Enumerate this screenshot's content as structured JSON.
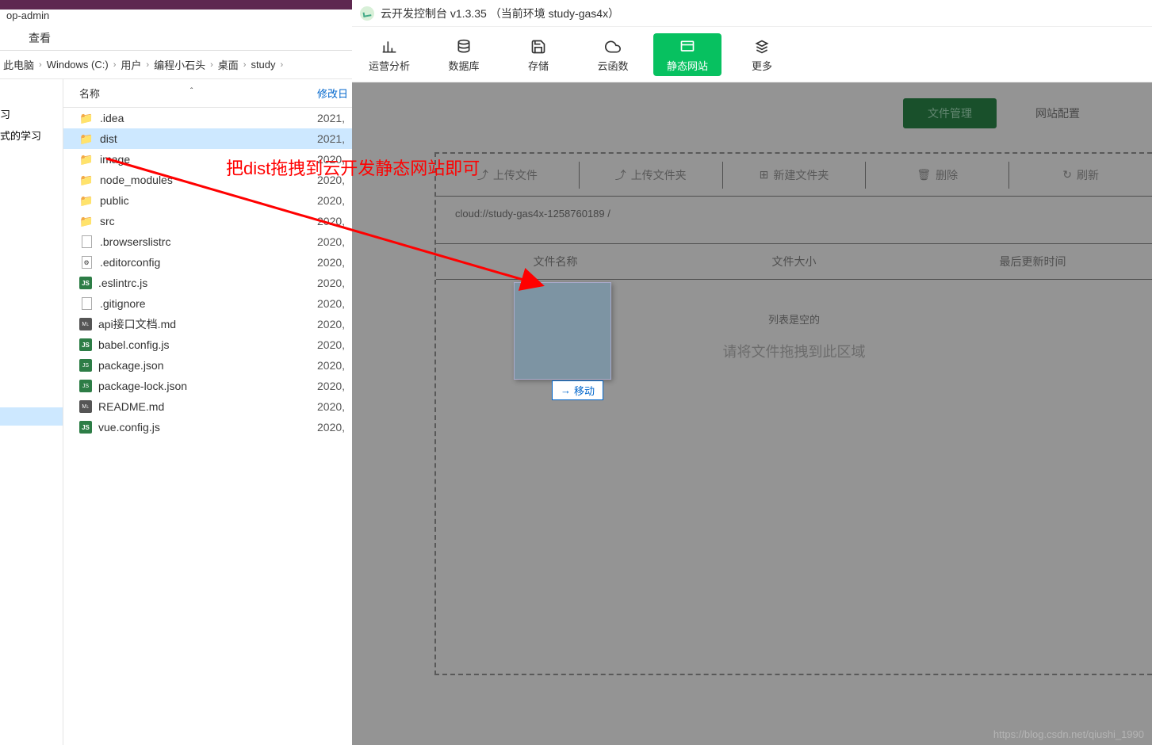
{
  "explorer": {
    "top_label": "op-admin",
    "menu": {
      "view": "查看"
    },
    "breadcrumb": [
      "此电脑",
      "Windows (C:)",
      "用户",
      "编程小石头",
      "桌面",
      "study"
    ],
    "sidebar": {
      "item1": "习",
      "item2": "式的学习"
    },
    "columns": {
      "name": "名称",
      "date": "修改日"
    },
    "files": [
      {
        "name": ".idea",
        "type": "folder",
        "date": "2021,"
      },
      {
        "name": "dist",
        "type": "folder",
        "date": "2021,",
        "selected": true
      },
      {
        "name": "image",
        "type": "folder",
        "date": "2020,"
      },
      {
        "name": "node_modules",
        "type": "folder",
        "date": "2020,"
      },
      {
        "name": "public",
        "type": "folder",
        "date": "2020,"
      },
      {
        "name": "src",
        "type": "folder",
        "date": "2020,"
      },
      {
        "name": ".browserslistrc",
        "type": "file",
        "date": "2020,"
      },
      {
        "name": ".editorconfig",
        "type": "cfg",
        "date": "2020,"
      },
      {
        "name": ".eslintrc.js",
        "type": "js",
        "date": "2020,"
      },
      {
        "name": ".gitignore",
        "type": "file",
        "date": "2020,"
      },
      {
        "name": "api接口文档.md",
        "type": "md",
        "date": "2020,"
      },
      {
        "name": "babel.config.js",
        "type": "js",
        "date": "2020,"
      },
      {
        "name": "package.json",
        "type": "json",
        "date": "2020,"
      },
      {
        "name": "package-lock.json",
        "type": "json",
        "date": "2020,"
      },
      {
        "name": "README.md",
        "type": "md",
        "date": "2020,"
      },
      {
        "name": "vue.config.js",
        "type": "js",
        "date": "2020,"
      }
    ]
  },
  "console": {
    "title": "云开发控制台 v1.3.35 （当前环境 study-gas4x）",
    "toolbar": [
      {
        "label": "运营分析",
        "icon": "chart"
      },
      {
        "label": "数据库",
        "icon": "database"
      },
      {
        "label": "存储",
        "icon": "save"
      },
      {
        "label": "云函数",
        "icon": "cloud"
      },
      {
        "label": "静态网站",
        "icon": "website",
        "active": true
      },
      {
        "label": "更多",
        "icon": "more"
      }
    ],
    "tabs": {
      "file_mgmt": "文件管理",
      "site_config": "网站配置"
    },
    "actions": {
      "upload_file": "上传文件",
      "upload_folder": "上传文件夹",
      "new_folder": "新建文件夹",
      "delete": "删除",
      "refresh": "刷新"
    },
    "path": "cloud://study-gas4x-1258760189 /",
    "cols": {
      "name": "文件名称",
      "size": "文件大小",
      "updated": "最后更新时间"
    },
    "empty_title": "列表是空的",
    "empty_msg": "请将文件拖拽到此区域",
    "drag_label": "移动"
  },
  "annotation": "把dist拖拽到云开发静态网站即可",
  "watermark": "https://blog.csdn.net/qiushi_1990"
}
